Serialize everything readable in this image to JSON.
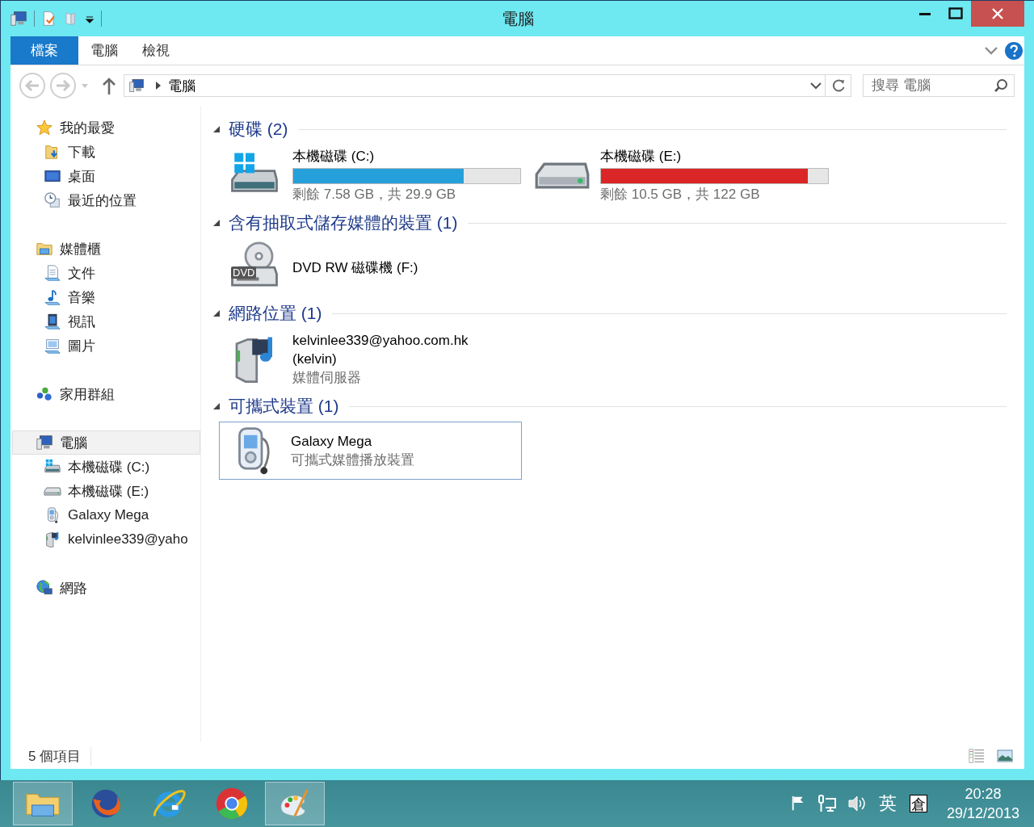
{
  "window": {
    "title": "電腦"
  },
  "ribbon": {
    "tabs": [
      {
        "label": "檔案",
        "kind": "file"
      },
      {
        "label": "電腦",
        "kind": "tab"
      },
      {
        "label": "檢視",
        "kind": "tab"
      }
    ]
  },
  "address": {
    "path": "電腦",
    "search": {
      "placeholder": "搜尋 電腦"
    }
  },
  "navigation": {
    "groups": [
      {
        "label": "我的最愛",
        "selected": false,
        "children": [
          {
            "label": "下載",
            "selected": false
          },
          {
            "label": "桌面",
            "selected": false
          },
          {
            "label": "最近的位置",
            "selected": false
          }
        ]
      },
      {
        "label": "媒體櫃",
        "selected": false,
        "children": [
          {
            "label": "文件",
            "selected": false
          },
          {
            "label": "音樂",
            "selected": false
          },
          {
            "label": "視訊",
            "selected": false
          },
          {
            "label": "圖片",
            "selected": false
          }
        ]
      },
      {
        "label": "家用群組",
        "selected": false
      },
      {
        "label": "電腦",
        "selected": true,
        "children": [
          {
            "label": "本機磁碟 (C:)",
            "selected": false
          },
          {
            "label": "本機磁碟 (E:)",
            "selected": false
          },
          {
            "label": "Galaxy Mega",
            "selected": false
          },
          {
            "label": "kelvinlee339@yaho",
            "selected": false
          }
        ]
      },
      {
        "label": "網路",
        "selected": false
      }
    ]
  },
  "sections": [
    {
      "title": "硬碟 (2)",
      "expanded": true,
      "items": [
        {
          "kind": "system_drive",
          "name": "本機磁碟 (C:)",
          "level": 0.75,
          "color": "#26a0da",
          "reading": "剩餘 7.58 GB，共 29.9 GB"
        },
        {
          "kind": "drive",
          "name": "本機磁碟 (E:)",
          "level": 0.91,
          "color": "#da2626",
          "reading": "剩餘 10.5 GB，共 122 GB"
        }
      ]
    },
    {
      "title": "含有抽取式儲存媒體的裝置 (1)",
      "expanded": true,
      "items": [
        {
          "kind": "optical_drive",
          "name": "DVD RW 磁碟機 (F:)",
          "icon_label": "DVD"
        }
      ]
    },
    {
      "title": "網路位置 (1)",
      "expanded": true,
      "items": [
        {
          "kind": "media_server",
          "name": "kelvinlee339@yahoo.com.hk (kelvin)",
          "subtitle": "媒體伺服器"
        }
      ]
    },
    {
      "title": "可攜式裝置 (1)",
      "expanded": true,
      "items": [
        {
          "kind": "portable_device",
          "name": "Galaxy Mega",
          "subtitle": "可攜式媒體播放裝置",
          "selected": true
        }
      ]
    }
  ],
  "status_bar": {
    "count": "5 個項目"
  },
  "taskbar": {
    "apps": [
      {
        "selected": true
      },
      {
        "selected": false
      },
      {
        "selected": false
      },
      {
        "selected": false
      },
      {
        "selected": true
      }
    ],
    "tray": {
      "language": "英",
      "ime": "倉",
      "time": "20:28",
      "date": "29/12/2013"
    }
  }
}
